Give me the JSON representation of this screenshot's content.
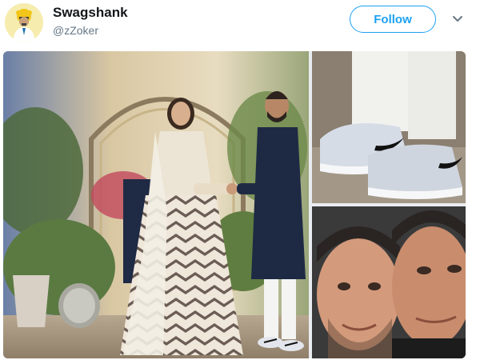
{
  "user": {
    "display_name": "Swagshank",
    "handle": "@zZoker",
    "avatar_icon": "avatar-icon"
  },
  "actions": {
    "follow_label": "Follow",
    "more_icon": "chevron-down-icon"
  },
  "colors": {
    "accent": "#1da1f2",
    "name": "#14171a",
    "muted": "#657786"
  },
  "media": {
    "photos": [
      "wedding-couple-photo",
      "sneakers-closeup-photo",
      "faces-closeup-photo"
    ]
  }
}
